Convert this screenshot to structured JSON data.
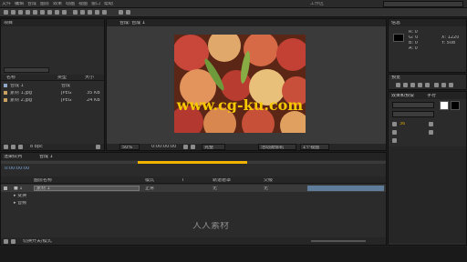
{
  "menubar": {
    "items": [
      "文件",
      "编辑",
      "合成",
      "图层",
      "效果",
      "动画",
      "视图",
      "窗口",
      "帮助"
    ],
    "workspace": "工作区"
  },
  "project": {
    "tab": "项目",
    "search_placeholder": "",
    "columns": [
      "名称",
      "类型",
      "大小"
    ],
    "items": [
      {
        "name": "合成 1",
        "type": "合成",
        "size": ""
      },
      {
        "name": "素材 1.jpg",
        "type": "JPEG",
        "size": "35 KB"
      },
      {
        "name": "素材 2.jpg",
        "type": "JPEG",
        "size": "24 KB"
      }
    ],
    "footer": "8 bpc"
  },
  "info": {
    "tab": "信息",
    "r": "R: 0",
    "g": "G: 0",
    "b": "B: 0",
    "a": "A: 0",
    "x": "X: 1220",
    "y": "Y: 508"
  },
  "preview": {
    "tab": "预览",
    "label": "RAM预览选项"
  },
  "effects": {
    "tab": "效果和预设",
    "character_tab": "字符",
    "font_name": "",
    "size_value": "36"
  },
  "viewer": {
    "tab": "合成: 合成 1",
    "watermark": "www.cg-ku.com",
    "zoom": "50%",
    "time": "0:00:00:00",
    "resolution": "完整",
    "camera": "活动摄像机",
    "view": "1个视图"
  },
  "timeline": {
    "tab_render": "渲染队列",
    "tab_comp": "合成 1",
    "timecode": "0:00:00:00",
    "columns": [
      "图层名称",
      "模式",
      "T",
      "轨道遮罩",
      "父级"
    ],
    "layer_name": "素材 1",
    "rows": [
      {
        "label": "■ 1",
        "name": "素材 1",
        "mode": "正常",
        "track": "无",
        "parent": "无"
      },
      {
        "label": "▸ 变换",
        "name": "",
        "mode": "",
        "track": "",
        "parent": ""
      },
      {
        "label": "▸ 音频",
        "name": "",
        "mode": "",
        "track": "",
        "parent": ""
      }
    ],
    "footer_left": "切换开关/模式",
    "watermark_text": "人人素材"
  },
  "colors": {
    "accent": "#f0b400",
    "panel": "#2b2b2b",
    "bg": "#1e1e1e"
  }
}
